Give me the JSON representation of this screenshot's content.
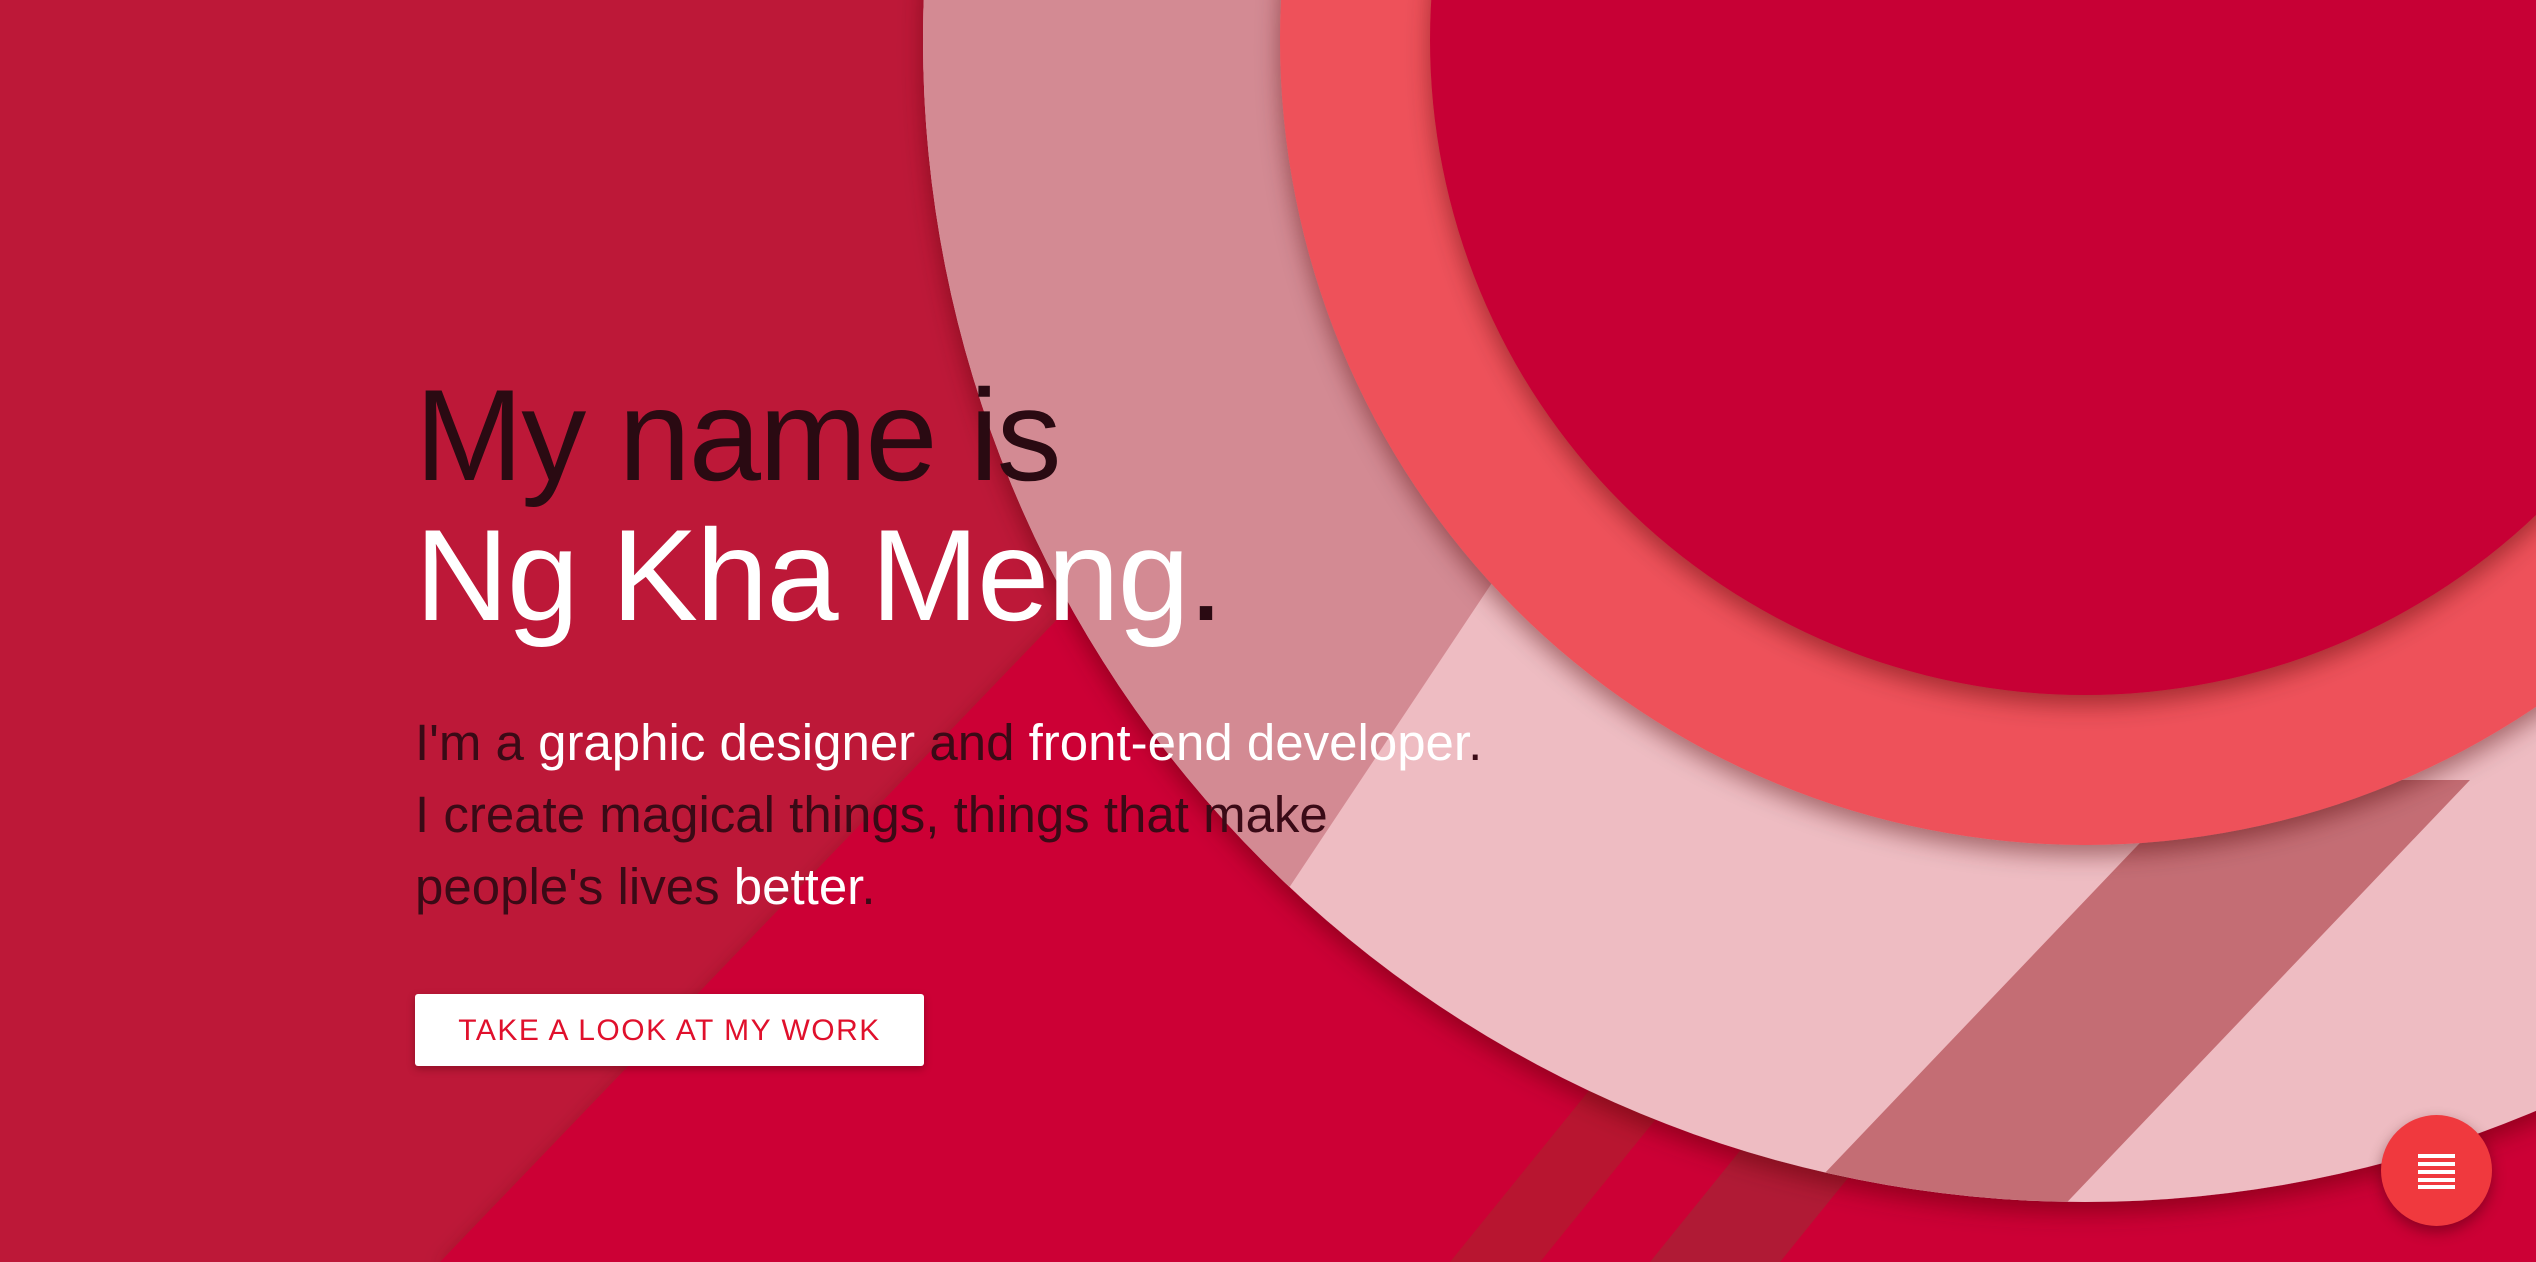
{
  "hero": {
    "headline_line1": "My name is",
    "headline_name": "Ng Kha Meng",
    "headline_dot": ".",
    "intro": {
      "line1_a": "I'm a ",
      "line1_role1": "graphic designer",
      "line1_b": " and ",
      "line1_role2": "front-end developer",
      "line1_end": ".",
      "line2": "I create magical things, things that make",
      "line3_a": "people's lives ",
      "line3_hl": "better",
      "line3_end": "."
    }
  },
  "cta": {
    "label": "TAKE A LOOK AT MY WORK"
  },
  "fab": {
    "icon": "menu-icon"
  },
  "colors": {
    "background": "#bd1838",
    "accent": "#f0393e",
    "button_text": "#e0102c",
    "inner_circle": "#c70034"
  }
}
